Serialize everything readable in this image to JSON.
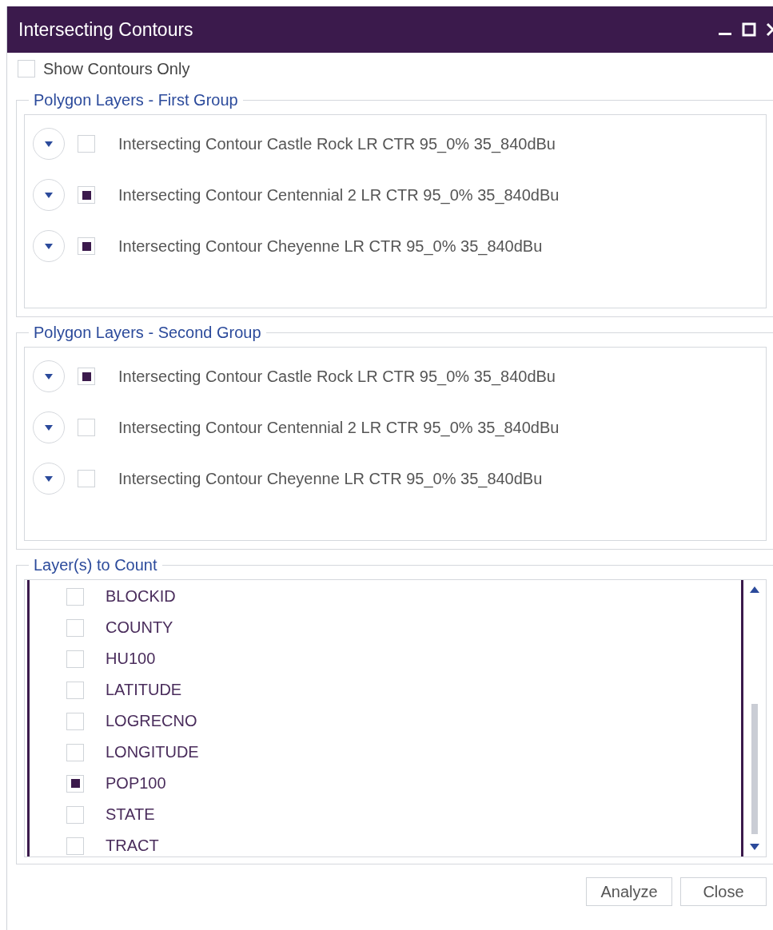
{
  "window": {
    "title": "Intersecting Contours"
  },
  "show_contours_only": {
    "label": "Show Contours Only",
    "checked": false
  },
  "groups": [
    {
      "title": "Polygon Layers - First Group",
      "items": [
        {
          "label": "Intersecting Contour Castle Rock LR CTR 95_0% 35_840dBu",
          "checked": false
        },
        {
          "label": "Intersecting Contour Centennial 2 LR CTR 95_0% 35_840dBu",
          "checked": true
        },
        {
          "label": "Intersecting Contour Cheyenne LR CTR 95_0% 35_840dBu",
          "checked": true
        }
      ]
    },
    {
      "title": "Polygon Layers - Second Group",
      "items": [
        {
          "label": "Intersecting Contour Castle Rock LR CTR 95_0% 35_840dBu",
          "checked": true
        },
        {
          "label": "Intersecting Contour Centennial 2 LR CTR 95_0% 35_840dBu",
          "checked": false
        },
        {
          "label": "Intersecting Contour Cheyenne LR CTR 95_0% 35_840dBu",
          "checked": false
        }
      ]
    }
  ],
  "count_layers": {
    "title": "Layer(s) to Count",
    "items": [
      {
        "label": "BLOCKID",
        "checked": false
      },
      {
        "label": "COUNTY",
        "checked": false
      },
      {
        "label": "HU100",
        "checked": false
      },
      {
        "label": "LATITUDE",
        "checked": false
      },
      {
        "label": "LOGRECNO",
        "checked": false
      },
      {
        "label": "LONGITUDE",
        "checked": false
      },
      {
        "label": "POP100",
        "checked": true
      },
      {
        "label": "STATE",
        "checked": false
      },
      {
        "label": "TRACT",
        "checked": false
      }
    ]
  },
  "buttons": [
    "Analyze",
    "Close"
  ]
}
